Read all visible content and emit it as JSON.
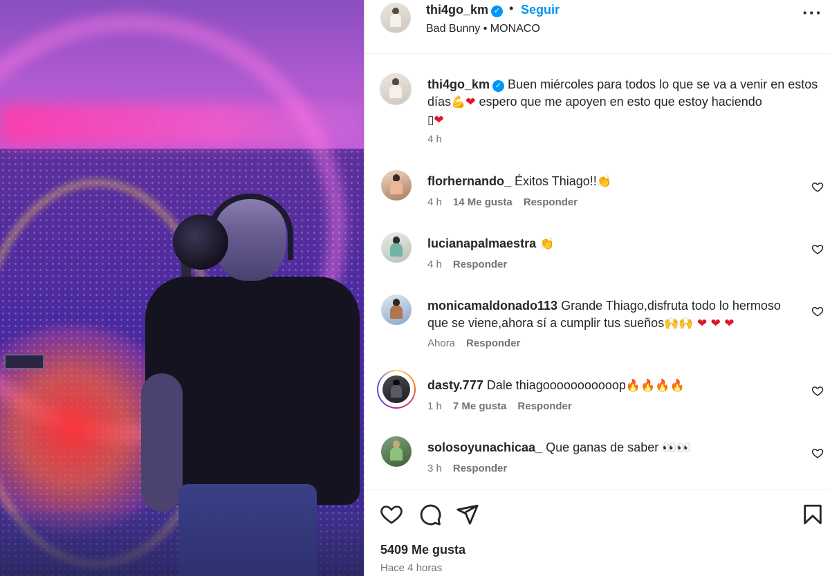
{
  "post": {
    "username": "thi4go_km",
    "follow_label": "Seguir",
    "subtitle": "Bad Bunny • MONACO",
    "caption": {
      "username": "thi4go_km",
      "text_1": "Buen miércoles para todos lo que se va a venir en estos días",
      "text_2": " espero que me apoyen en esto que estoy haciendo",
      "time": "4 h"
    }
  },
  "comments": [
    {
      "username": "florhernando_",
      "text": "Éxitos Thiago!!",
      "time": "4 h",
      "likes": "14 Me gusta",
      "reply": "Responder"
    },
    {
      "username": "lucianapalmaestra",
      "text": "",
      "time": "4 h",
      "likes": "",
      "reply": "Responder"
    },
    {
      "username": "monicamaldonado113",
      "text": "Grande Thiago,disfruta todo lo hermoso que se viene,ahora sí a cumplir tus sueños",
      "time": "Ahora",
      "likes": "",
      "reply": "Responder"
    },
    {
      "username": "dasty.777",
      "text": "Dale thiagooooooooooop",
      "time": "1 h",
      "likes": "7 Me gusta",
      "reply": "Responder"
    },
    {
      "username": "solosoyunachicaa_",
      "text": "Que ganas de saber",
      "time": "3 h",
      "likes": "",
      "reply": "Responder"
    }
  ],
  "footer": {
    "likes": "5409 Me gusta",
    "ago": "Hace 4 horas"
  },
  "icons": {
    "verified": "verified-badge-icon",
    "more": "more-options-icon",
    "like": "heart-icon",
    "comment": "comment-icon",
    "share": "send-icon",
    "save": "bookmark-icon"
  },
  "colors": {
    "accent": "#0095f6",
    "secondary_text": "#737373",
    "primary_text": "#262626",
    "heart_emoji": "#e0152b"
  }
}
